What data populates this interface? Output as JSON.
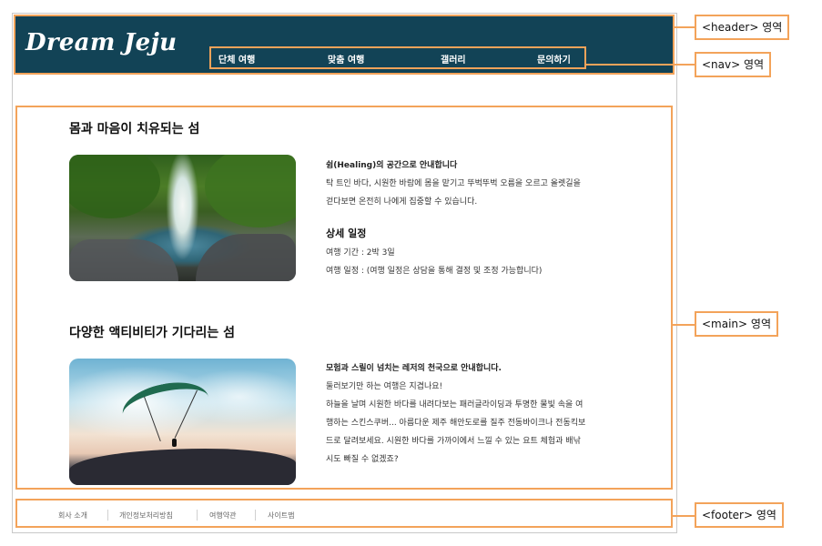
{
  "header": {
    "brand": "Dream Jeju",
    "nav": [
      "단체 여행",
      "맞춤 여행",
      "갤러리",
      "문의하기"
    ]
  },
  "main": {
    "sections": [
      {
        "title": "몸과 마음이 치유되는 섬",
        "image_icon": "waterfall-photo",
        "lines": [
          "쉼(Healing)의 공간으로 안내합니다",
          "탁 트인 바다, 시원한 바람에 몸을 맡기고 뚜벅뚜벅 오름을 오르고 올렛길을",
          "걷다보면 온전히 나에게 집중할 수 있습니다."
        ],
        "subhead": "상세 일정",
        "detail_lines": [
          "여행 기간 : 2박 3일",
          "여행 일정 : (여행 일정은 상담을 통해 결정 및 조정 가능합니다)"
        ]
      },
      {
        "title": "다양한 액티비티가 기다리는 섬",
        "image_icon": "paraglider-photo",
        "lines": [
          "모험과 스릴이 넘치는 레저의 천국으로 안내합니다.",
          "둘러보기만 하는 여행은 지겹나요!",
          "하늘을 날며 시원한 바다를 내려다보는 패러글라이딩과 투명한 물빛 속을 여",
          "행하는 스킨스쿠버... 아름다운 제주 해안도로를 질주 전동바이크나 전동킥보",
          "드로 달려보세요. 시원한 바다를 가까이에서 느낄 수 있는 요트 체험과 배낚",
          "시도 빠질 수 없겠죠?"
        ]
      }
    ]
  },
  "footer": {
    "links": [
      "회사 소개",
      "개인정보처리방침",
      "여행약관",
      "사이트맵"
    ]
  },
  "annotations": {
    "header": "<header> 영역",
    "nav": "<nav> 영역",
    "main": "<main> 영역",
    "footer": "<footer> 영역"
  },
  "colors": {
    "header_bg": "#124356",
    "annotation_orange": "#f3a35a"
  }
}
